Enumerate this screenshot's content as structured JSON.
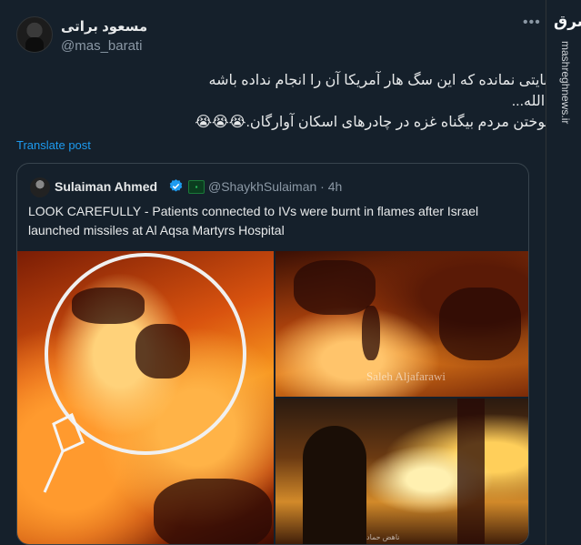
{
  "tweet": {
    "display_name": "مسعود براتی",
    "handle": "@mas_barati",
    "more_label": "•••",
    "lines": [
      "جنایتی نمانده که این سگ هار آمریکا آن را انجام نداده باشه",
      "یا الله...",
      "سوختن مردم بیگناه غزه در چادرهای اسکان آوارگان.😭😭😭"
    ],
    "translate_label": "Translate post"
  },
  "quote": {
    "name": "Sulaiman Ahmed",
    "handle_time": "@ShaykhSulaiman · 4h",
    "text": "LOOK CAREFULLY - Patients connected to IVs were burnt in flames after Israel launched missiles at Al Aqsa Martyrs Hospital",
    "media": {
      "watermark": "Saleh Aljafarawi",
      "small_caption": "ناهض حماد"
    }
  },
  "brand": {
    "logo": "مشرق",
    "url": "mashreghnews.ir"
  },
  "colors": {
    "background": "#15202b",
    "link": "#1d9bf0",
    "verified": "#1d9bf0"
  }
}
